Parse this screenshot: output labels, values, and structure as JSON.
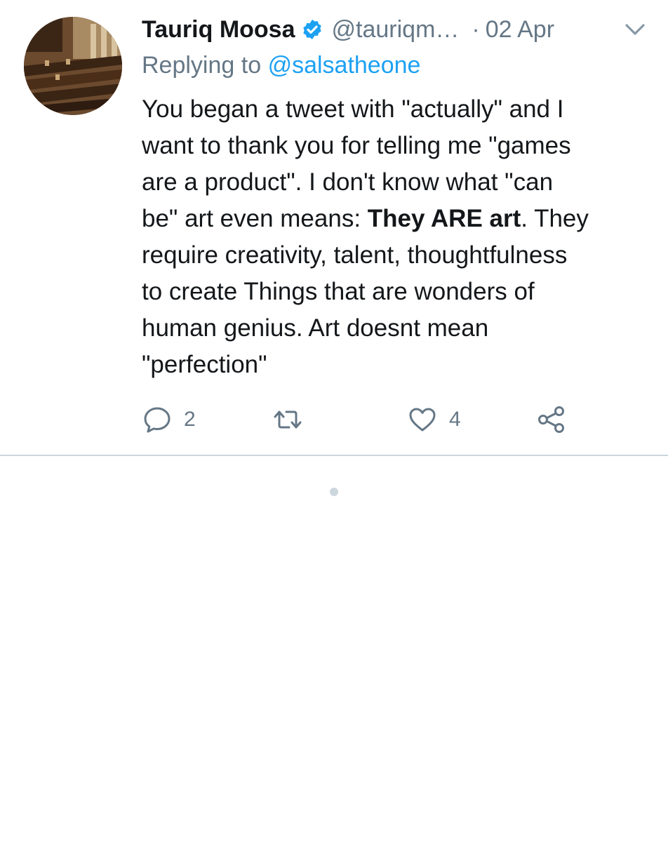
{
  "tweet": {
    "author_name": "Tauriq Moosa",
    "author_handle": "@tauriqm…",
    "separator": "·",
    "date": "02 Apr",
    "replying_prefix": "Replying to",
    "replying_to": "@salsatheone",
    "text_before_bold": "You began a tweet with \"actually\" and I\nwant to thank you for telling me \"games\nare a product\". I don't know what \"can\nbe\" art even means: ",
    "text_bold": "They ARE art",
    "text_after_bold": ". They\nrequire creativity, talent, thoughtfulness\nto create Things that are wonders of\nhuman genius. Art doesnt mean\n\"perfection\"",
    "reply_count": "2",
    "retweet_count": "",
    "like_count": "4"
  },
  "colors": {
    "accent": "#1da1f2",
    "secondary_text": "#657786",
    "primary_text": "#14171a",
    "divider": "#ccd6dd"
  },
  "icons": {
    "verified": "verified-badge-icon",
    "menu": "chevron-down-icon",
    "reply": "reply-icon",
    "retweet": "retweet-icon",
    "like": "heart-icon",
    "share": "share-icon"
  }
}
